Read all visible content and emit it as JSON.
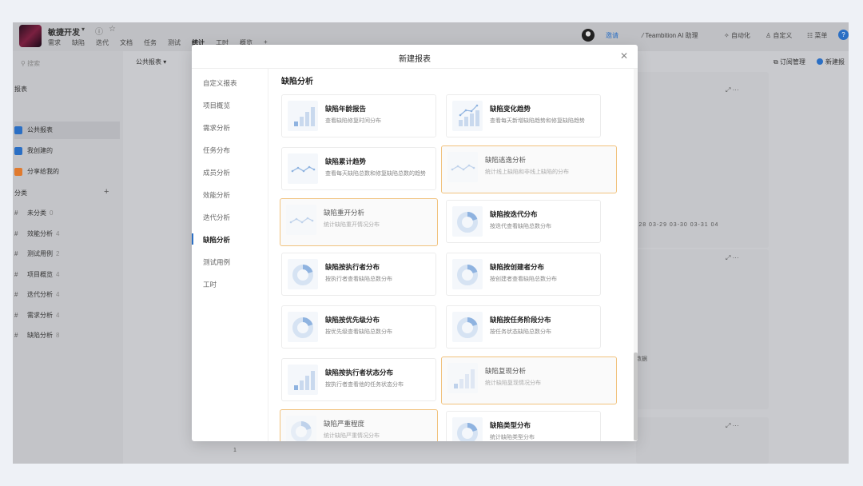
{
  "project": {
    "name": "敏捷开发",
    "caret": "▾",
    "info_icon": "ⓘ",
    "star_icon": "☆"
  },
  "top_tabs": [
    "需求",
    "缺陷",
    "迭代",
    "文档",
    "任务",
    "测试",
    "统计",
    "工时",
    "概览",
    "+"
  ],
  "active_tab": "统计",
  "top_actions": {
    "invite": "邀请",
    "ai": "Teambition AI 助理",
    "automation": "自动化",
    "customize": "自定义",
    "menu": "菜单",
    "help": "?"
  },
  "sidebar": {
    "search_placeholder": "搜索",
    "reports_header": "报表",
    "report_items": [
      {
        "label": "公共报表",
        "color": "#2b6fc4"
      },
      {
        "label": "我创建的",
        "color": "#2b6fc4"
      },
      {
        "label": "分享给我的",
        "color": "#e07a2e"
      }
    ],
    "category_header": "分类",
    "add_icon": "+",
    "categories": [
      {
        "label": "未分类",
        "count": "0"
      },
      {
        "label": "效能分析",
        "count": "4"
      },
      {
        "label": "测试用例",
        "count": "2"
      },
      {
        "label": "项目概览",
        "count": "4"
      },
      {
        "label": "迭代分析",
        "count": "4"
      },
      {
        "label": "需求分析",
        "count": "4"
      },
      {
        "label": "缺陷分析",
        "count": "8"
      }
    ]
  },
  "subbar": {
    "title": "公共报表 ▾",
    "subscribe": "订阅管理",
    "new_report": "新建报"
  },
  "background": {
    "axis_ticks": "-28   03-29   03-30   03-31   04",
    "card_text": "数据",
    "card_icons": "⤢   ···",
    "row_number": "1"
  },
  "modal": {
    "title": "新建报表",
    "close": "✕",
    "nav": [
      "自定义报表",
      "项目概览",
      "需求分析",
      "任务分布",
      "成员分析",
      "效能分析",
      "迭代分析",
      "缺陷分析",
      "测试用例",
      "工时"
    ],
    "active_nav": "缺陷分析",
    "section_title": "缺陷分析",
    "cards": [
      {
        "title": "缺陷年龄报告",
        "desc": "查看缺陷修复时间分布",
        "thumb": "bar",
        "highlighted": false
      },
      {
        "title": "缺陷变化趋势",
        "desc": "查看每天新增缺陷趋势和修复缺陷趋势",
        "thumb": "barline",
        "highlighted": false
      },
      {
        "title": "缺陷累计趋势",
        "desc": "查看每天缺陷总数和修复缺陷总数的趋势",
        "thumb": "line",
        "highlighted": false
      },
      {
        "title": "缺陷逃逸分析",
        "desc": "统计线上缺陷和非线上缺陷的分布",
        "thumb": "line",
        "highlighted": true
      },
      {
        "title": "缺陷重开分析",
        "desc": "统计缺陷重开情况分布",
        "thumb": "line",
        "highlighted": true
      },
      {
        "title": "缺陷按迭代分布",
        "desc": "按迭代查看缺陷总数分布",
        "thumb": "donut",
        "highlighted": false
      },
      {
        "title": "缺陷按执行者分布",
        "desc": "按执行者查看缺陷总数分布",
        "thumb": "donut",
        "highlighted": false
      },
      {
        "title": "缺陷按创建者分布",
        "desc": "按创建者查看缺陷总数分布",
        "thumb": "donut",
        "highlighted": false
      },
      {
        "title": "缺陷按优先级分布",
        "desc": "按优先级查看缺陷总数分布",
        "thumb": "donut",
        "highlighted": false
      },
      {
        "title": "缺陷按任务阶段分布",
        "desc": "按任务状态缺陷总数分布",
        "thumb": "donut",
        "highlighted": false
      },
      {
        "title": "缺陷按执行者状态分布",
        "desc": "按执行者查看他的任务状态分布",
        "thumb": "bar",
        "highlighted": false
      },
      {
        "title": "缺陷复现分析",
        "desc": "统计缺陷复现情况分布",
        "thumb": "bar",
        "highlighted": true
      },
      {
        "title": "缺陷严重程度",
        "desc": "统计缺陷严重情况分布",
        "thumb": "donut",
        "highlighted": true
      },
      {
        "title": "缺陷类型分布",
        "desc": "统计缺陷类型分布",
        "thumb": "donut",
        "highlighted": false
      }
    ]
  },
  "colors": {
    "accent": "#2b6fc4",
    "highlight_border": "#f1c27d",
    "thumb_blue": "#8fb3e0"
  }
}
